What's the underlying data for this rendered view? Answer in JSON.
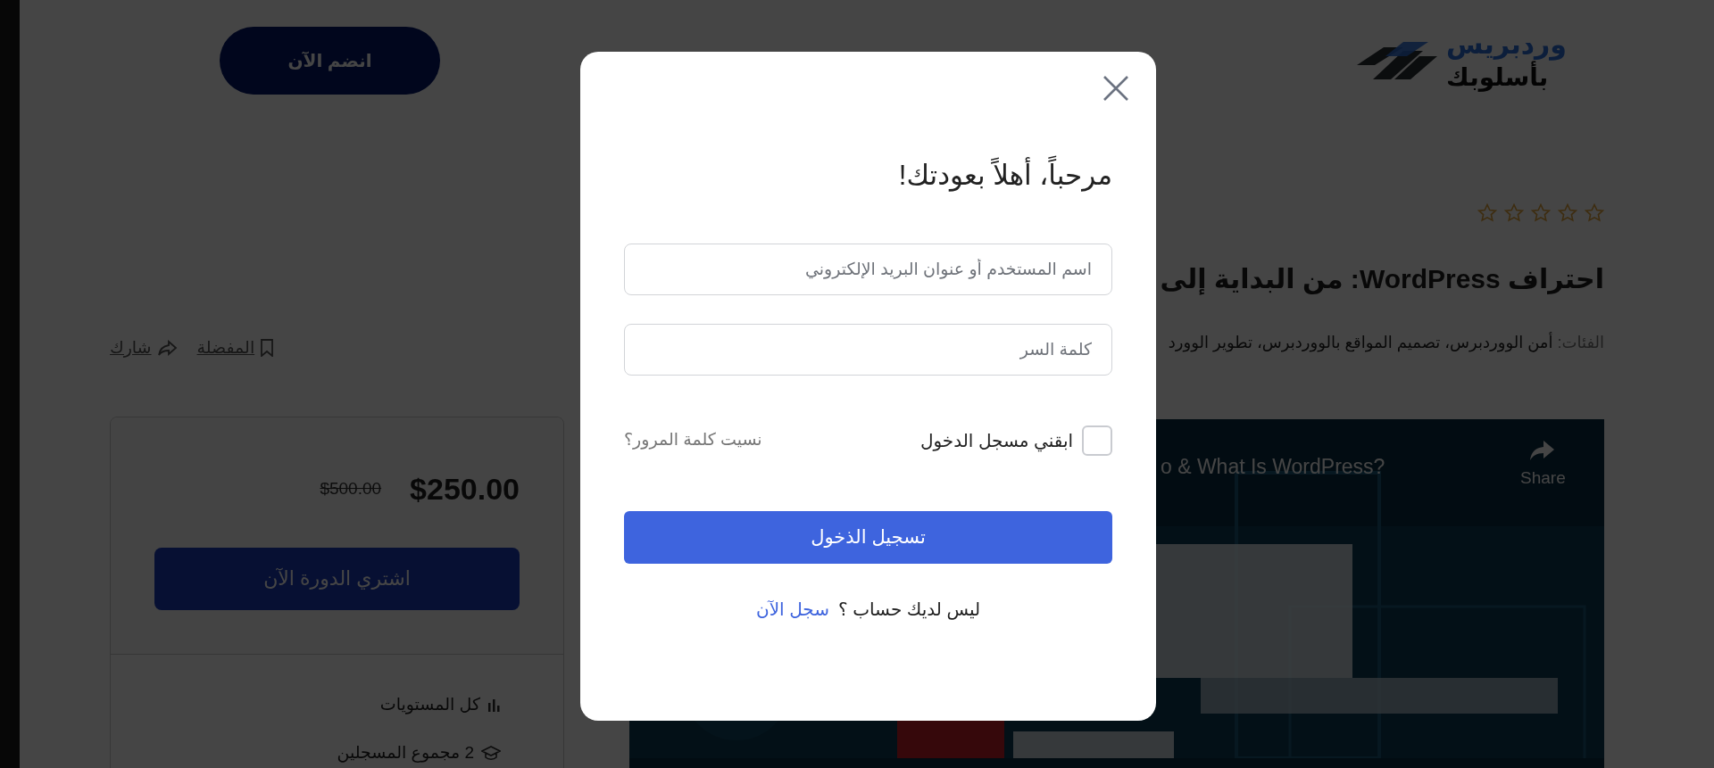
{
  "header": {
    "logo": {
      "line1": "وردبريس",
      "line2": "بأسلوبك"
    },
    "join_button": "انضم الآن"
  },
  "course": {
    "stars": 0,
    "title": "احتراف WordPress: من البداية إلى",
    "categories_label": "الفئات:",
    "categories": "أمن الووردبرس، تصميم المواقع بالووردبرس، تطوير الوورد",
    "actions": [
      {
        "kind": "wishlist",
        "label": "المفضلة"
      },
      {
        "kind": "share",
        "label": "شارك"
      }
    ]
  },
  "pricing": {
    "price": "$250.00",
    "old_price": "$500.00",
    "buy_button": "اشتري الدورة الآن",
    "meta": [
      {
        "kind": "level",
        "text": "كل المستويات"
      },
      {
        "kind": "enrolled",
        "text": "2 مجموع المسجلين"
      }
    ]
  },
  "video": {
    "title": "o & What Is WordPress?",
    "share": "Share"
  },
  "login_modal": {
    "title": "مرحباً، أهلاً بعودتك!",
    "fields": [
      {
        "placeholder": "اسم المستخدم أو عنوان البريد الإلكتروني"
      },
      {
        "placeholder": "كلمة السر"
      }
    ],
    "remember": {
      "label": "ابقني مسجل الدخول",
      "checked": false
    },
    "forgot_link": "نسيت كلمة المرور؟",
    "login_button": "تسجيل الذخول",
    "signup_prompt": "ليس لديك حساب ؟",
    "signup_link": "سجل الآن"
  }
}
